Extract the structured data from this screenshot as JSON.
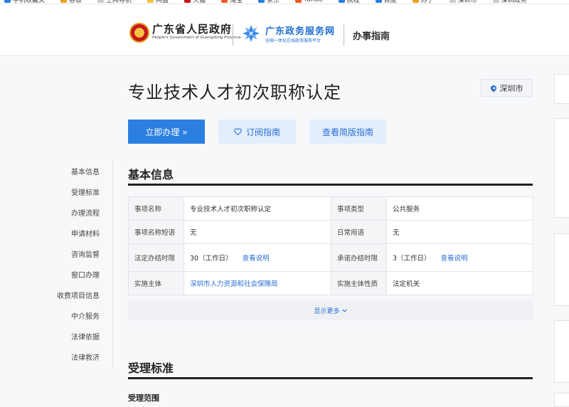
{
  "bookmarks": [
    {
      "label": "手机收藏夹",
      "color": "#2a7fe0"
    },
    {
      "label": "谷歌",
      "color": "#f0a020"
    },
    {
      "label": "上网导航",
      "color": "#cccccc"
    },
    {
      "label": "网盘",
      "color": "#f5c342"
    },
    {
      "label": "天猫",
      "color": "#c8161d"
    },
    {
      "label": "淘宝",
      "color": "#f05a24"
    },
    {
      "label": "京东",
      "color": "#2a7fe0"
    },
    {
      "label": "Yahoo",
      "color": "#f05a24"
    },
    {
      "label": "携程",
      "color": "#2a7fe0"
    },
    {
      "label": "百度",
      "color": "#2a7fe0"
    },
    {
      "label": "苏宁",
      "color": "#f0a020"
    },
    {
      "label": "深圳市",
      "color": "#cccccc"
    },
    {
      "label": "深圳政务",
      "color": "#cccccc"
    }
  ],
  "header": {
    "gov_name": "广东省人民政府",
    "gov_en": "People's Government of Guangdong Province",
    "service_name": "广东政务服务网",
    "service_sub": "全国一体化在线政务服务平台",
    "guide_title": "办事指南"
  },
  "main": {
    "title": "专业技术人才初次职称认定",
    "city": "深圳市",
    "buttons": {
      "apply": "立即办理 »",
      "subscribe": "订阅指南",
      "brief": "查看简版指南"
    }
  },
  "sidenav": [
    "基本信息",
    "受理标准",
    "办理流程",
    "申请材料",
    "咨询监督",
    "窗口办理",
    "收费项目信息",
    "中介服务",
    "法律依据",
    "法律救济"
  ],
  "basic_info": {
    "section_title": "基本信息",
    "rows": [
      {
        "l1": "事项名称",
        "v1": "专业技术人才初次职称认定",
        "l2": "事项类型",
        "v2": "公共服务"
      },
      {
        "l1": "事项名称短语",
        "v1": "无",
        "l2": "日常用语",
        "v2": "无"
      },
      {
        "l1": "法定办结时限",
        "v1": "30（工作日）",
        "link1": "查看说明",
        "l2": "承诺办结时限",
        "v2": "3（工作日）",
        "link2": "查看说明"
      },
      {
        "l1": "实施主体",
        "v1": "深圳市人力资源和社会保障局",
        "l2": "实施主体性质",
        "v2": "法定机关"
      }
    ],
    "show_more": "显示更多"
  },
  "acceptance": {
    "section_title": "受理标准",
    "sub_title": "受理范围"
  },
  "colors": {
    "accent": "#2a7fe0",
    "link": "#2a6fd6",
    "light_button": "#e3eefb"
  }
}
